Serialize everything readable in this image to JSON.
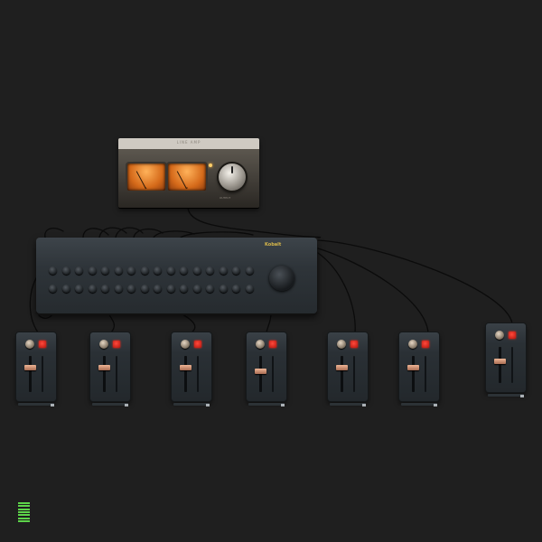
{
  "master": {
    "brand_label": "LINE AMP",
    "meter_left_label": "L",
    "meter_right_label": "R",
    "knob_label": "OUTPUT"
  },
  "console": {
    "brand_label": "Kobalt",
    "channel_count": 16
  },
  "modules": [
    {
      "label": "CH 1",
      "level": 0.72
    },
    {
      "label": "CH 2",
      "level": 0.7
    },
    {
      "label": "CH 3",
      "level": 0.72
    },
    {
      "label": "CH 4",
      "level": 0.6
    },
    {
      "label": "CH 5",
      "level": 0.7
    },
    {
      "label": "CH 6",
      "level": 0.72
    },
    {
      "label": "CH 7",
      "level": 0.62
    }
  ],
  "level_indicator": {
    "bars": 7,
    "color": "#5dd44a"
  },
  "colors": {
    "background": "#1f1f1f",
    "meter_face": "#d56a1a",
    "mute_button": "#ff2a1a",
    "cable": "#0d0d0d"
  }
}
